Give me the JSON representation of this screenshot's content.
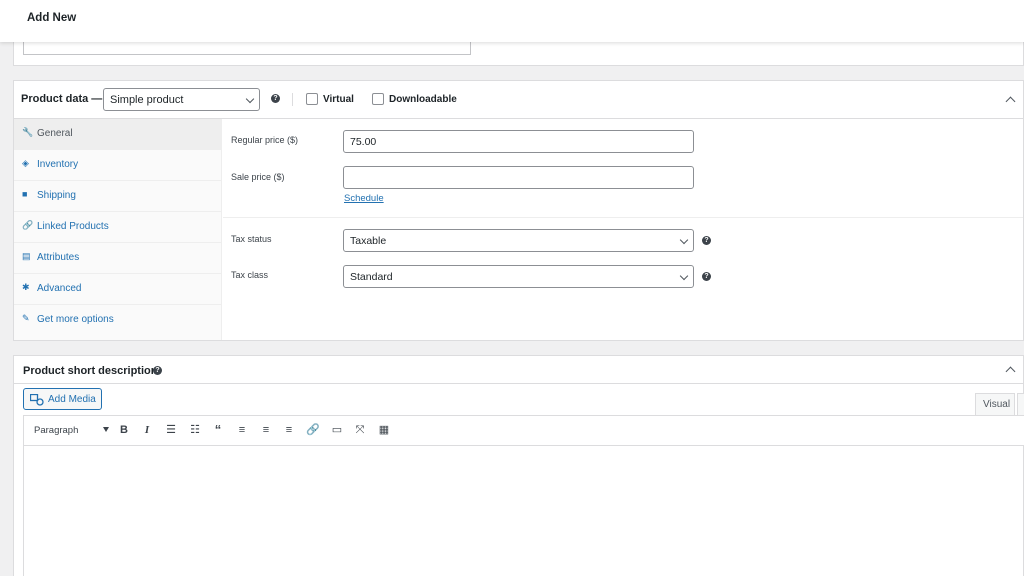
{
  "header": {
    "title": "Add New"
  },
  "product_data": {
    "title": "Product data —",
    "type_select": "Simple product",
    "virtual_label": "Virtual",
    "downloadable_label": "Downloadable",
    "tabs": [
      {
        "label": "General",
        "icon": "wrench-icon",
        "glyph": "🔧"
      },
      {
        "label": "Inventory",
        "icon": "tag-icon",
        "glyph": "◈"
      },
      {
        "label": "Shipping",
        "icon": "truck-icon",
        "glyph": "■"
      },
      {
        "label": "Linked Products",
        "icon": "link-icon",
        "glyph": "🔗"
      },
      {
        "label": "Attributes",
        "icon": "list-icon",
        "glyph": "▤"
      },
      {
        "label": "Advanced",
        "icon": "gear-icon",
        "glyph": "✱"
      },
      {
        "label": "Get more options",
        "icon": "plugin-icon",
        "glyph": "✎"
      }
    ],
    "fields": {
      "regular_price_label": "Regular price ($)",
      "regular_price_value": "75.00",
      "sale_price_label": "Sale price ($)",
      "sale_price_value": "",
      "schedule_link": "Schedule",
      "tax_status_label": "Tax status",
      "tax_status_value": "Taxable",
      "tax_class_label": "Tax class",
      "tax_class_value": "Standard"
    }
  },
  "short_description": {
    "title": "Product short description",
    "add_media": "Add Media",
    "visual_tab": "Visual",
    "format_select": "Paragraph"
  },
  "colors": {
    "accent": "#2271b1",
    "text": "#1d2327",
    "border": "#dcdcde"
  }
}
